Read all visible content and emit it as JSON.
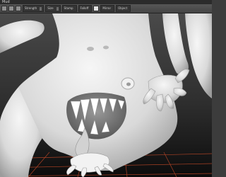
{
  "window": {
    "title": "Mud"
  },
  "toolbar": {
    "groups": [
      {
        "label": "Strength",
        "value": ""
      },
      {
        "label": "Size",
        "value": ""
      },
      {
        "label": "Stamp",
        "value": ""
      },
      {
        "label": "Falloff",
        "value": ""
      },
      {
        "label": "Mirror",
        "value": ""
      },
      {
        "label": "Object",
        "value": ""
      }
    ]
  },
  "viewport": {
    "background_top": "#4a4a4a",
    "background_bottom": "#0c0c0c",
    "model_color": "#e6e6e6",
    "grid_color": "#c64a28"
  }
}
